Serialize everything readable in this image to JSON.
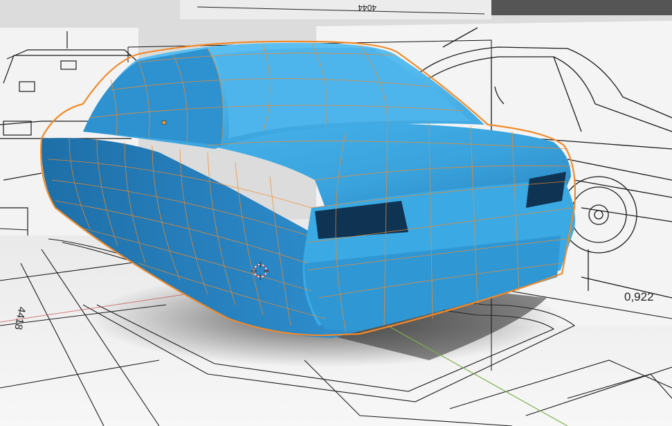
{
  "viewport": {
    "colors": {
      "background": "#dcdcdc",
      "floor": "#f2f2f2",
      "blueprint_line": "#1a1a1a",
      "model_blue": "#3aa3dd",
      "model_blue_dark": "#1c5f93",
      "wireframe": "#f08a2a",
      "shadow": "#2a2a2a",
      "axis_green": "#7fae4f",
      "axis_red": "#c44a4a"
    },
    "blueprints": {
      "top_dimension": "4044",
      "side_dimension": "0,922",
      "floor_dimension": "4418"
    },
    "icons": [
      "3d-cursor-icon",
      "object-origin-icon"
    ]
  }
}
